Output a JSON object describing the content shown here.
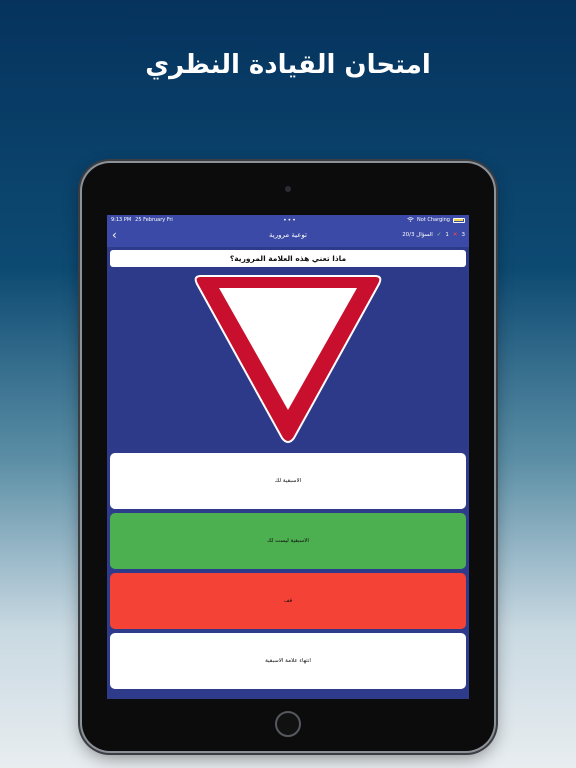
{
  "promo": {
    "headline": "امتحان القيادة النظري"
  },
  "status_bar": {
    "time": "9:13 PM",
    "date": "25 February Fri",
    "dots": "•••",
    "network": "Not Charging"
  },
  "nav": {
    "back_glyph": "‹",
    "title": "توعية مرورية",
    "wrong_count": "3",
    "wrong_glyph": "✕",
    "right_count": "1",
    "right_glyph": "✓",
    "question_progress": "السؤال 20/3"
  },
  "question": {
    "text": "ماذا تعني هذه العلامة المرورية؟",
    "sign_icon": "yield-sign-icon"
  },
  "answers": [
    {
      "label": "الاسبقية لك",
      "state": "neutral"
    },
    {
      "label": "الاسبقية ليست لك",
      "state": "correct"
    },
    {
      "label": "قف",
      "state": "wrong"
    },
    {
      "label": "انتهاء علامة الاسبقية",
      "state": "neutral"
    }
  ],
  "colors": {
    "nav": "#3b4aa6",
    "background": "#2e3a8a",
    "correct": "#4caf50",
    "wrong": "#f44336",
    "neutral": "#ffffff",
    "sign_border": "#c8102e"
  }
}
